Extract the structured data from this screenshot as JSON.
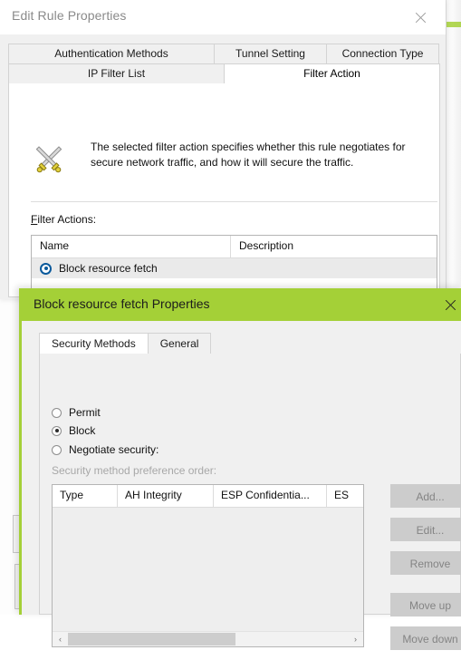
{
  "background": {
    "right_strip": "background-window-edge",
    "accent_color": "#a4d037"
  },
  "edit_rule_dialog": {
    "title": "Edit Rule Properties",
    "close_label": "Close",
    "tabs_row1": [
      {
        "label": "Authentication Methods",
        "active": false
      },
      {
        "label": "Tunnel Setting",
        "active": false
      },
      {
        "label": "Connection Type",
        "active": false
      }
    ],
    "tabs_row2": [
      {
        "label": "IP Filter List",
        "active": false
      },
      {
        "label": "Filter Action",
        "active": true
      }
    ],
    "info": {
      "icon": "crossed-swords-icon",
      "text": "The selected filter action specifies whether this rule negotiates for secure network traffic, and how it will secure the traffic."
    },
    "filter_actions": {
      "label_accel": "F",
      "label_rest": "ilter Actions:",
      "columns": [
        "Name",
        "Description"
      ],
      "rows": [
        {
          "selected": true,
          "name": "Block resource fetch",
          "description": ""
        }
      ]
    }
  },
  "properties_dialog": {
    "title": "Block resource fetch Properties",
    "titlebar_color": "#a4d037",
    "close_label": "Close",
    "tabs": [
      {
        "label": "Security Methods",
        "active": true
      },
      {
        "label": "General",
        "active": false
      }
    ],
    "security_action": {
      "options": [
        {
          "label": "Permit",
          "selected": false
        },
        {
          "label": "Block",
          "selected": true
        },
        {
          "label": "Negotiate security:",
          "selected": false
        }
      ]
    },
    "preference_label": "Security method preference order:",
    "methods_table": {
      "columns": [
        "Type",
        "AH Integrity",
        "ESP Confidentia...",
        "ES"
      ],
      "rows": []
    },
    "scrollbar": {
      "left_arrow": "‹",
      "right_arrow": "›",
      "thumb_percent": 60
    },
    "buttons": [
      {
        "label": "Add...",
        "enabled": false
      },
      {
        "label": "Edit...",
        "enabled": false
      },
      {
        "label": "Remove",
        "enabled": false
      },
      {
        "label": "Move up",
        "enabled": false
      },
      {
        "label": "Move down",
        "enabled": false
      }
    ]
  }
}
